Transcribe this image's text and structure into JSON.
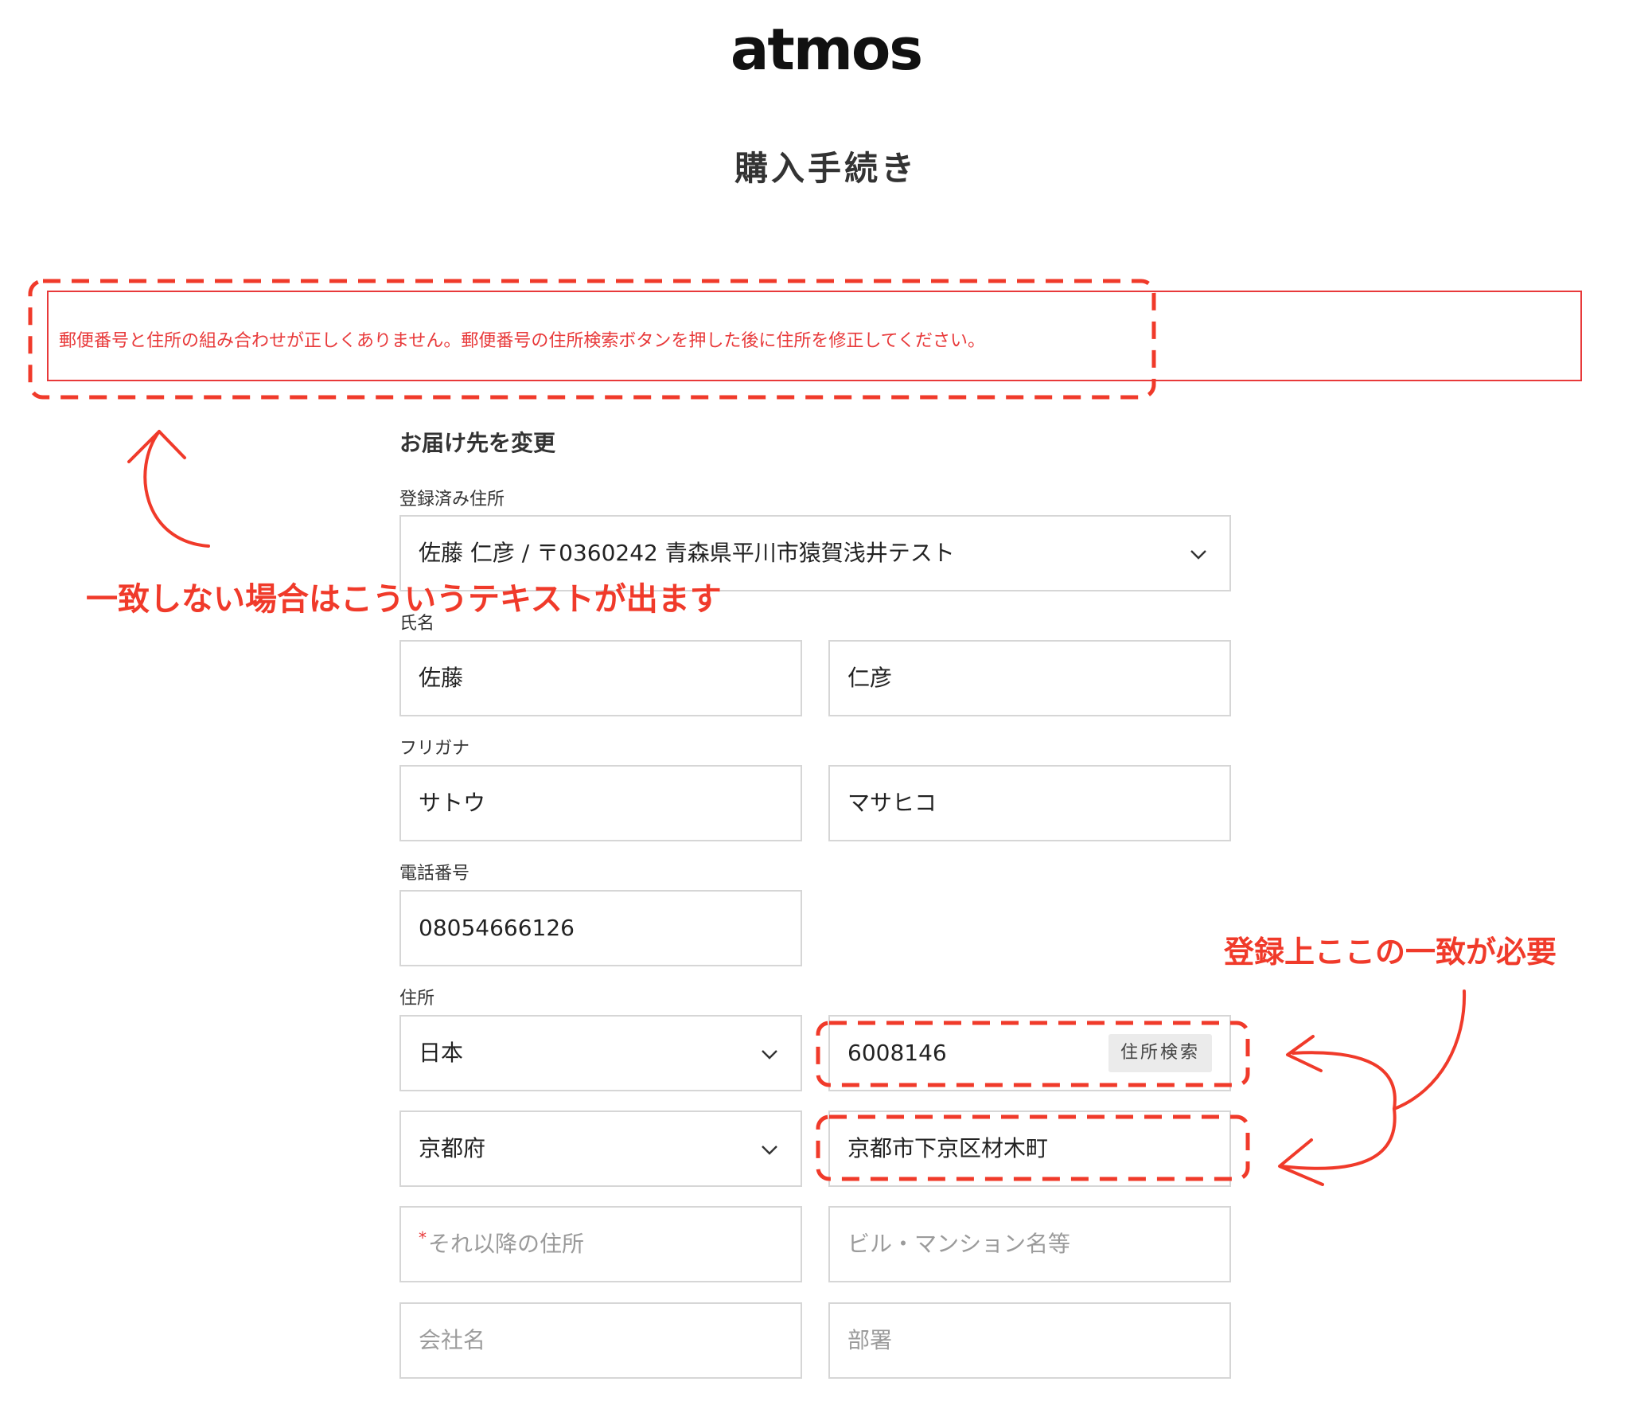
{
  "header": {
    "logo": "atmos",
    "page_title": "購入手続き"
  },
  "error": {
    "message": "郵便番号と住所の組み合わせが正しくありません。郵便番号の住所検索ボタンを押した後に住所を修正してください。"
  },
  "form": {
    "section_title": "お届け先を変更",
    "saved_address": {
      "label": "登録済み住所",
      "value": "佐藤 仁彦 / 〒0360242 青森県平川市猿賀浅井テスト"
    },
    "name": {
      "label": "氏名",
      "last": "佐藤",
      "first": "仁彦"
    },
    "kana": {
      "label": "フリガナ",
      "last": "サトウ",
      "first": "マサヒコ"
    },
    "phone": {
      "label": "電話番号",
      "value": "08054666126"
    },
    "address": {
      "label": "住所",
      "country": "日本",
      "postal_code": "6008146",
      "search_button": "住所検索",
      "prefecture": "京都府",
      "city": "京都市下京区材木町",
      "street_required_mark": "*",
      "street_placeholder": "それ以降の住所",
      "building_placeholder": "ビル・マンション名等",
      "company_placeholder": "会社名",
      "department_placeholder": "部署"
    }
  },
  "annotations": {
    "error_note": "一致しない場合はこういうテキストが出ます",
    "match_note": "登録上ここの一致が必要",
    "color": "#f03a2a"
  },
  "colors": {
    "error": "#e8393a",
    "border": "#d6d6d6",
    "placeholder": "#9b9b9b"
  }
}
